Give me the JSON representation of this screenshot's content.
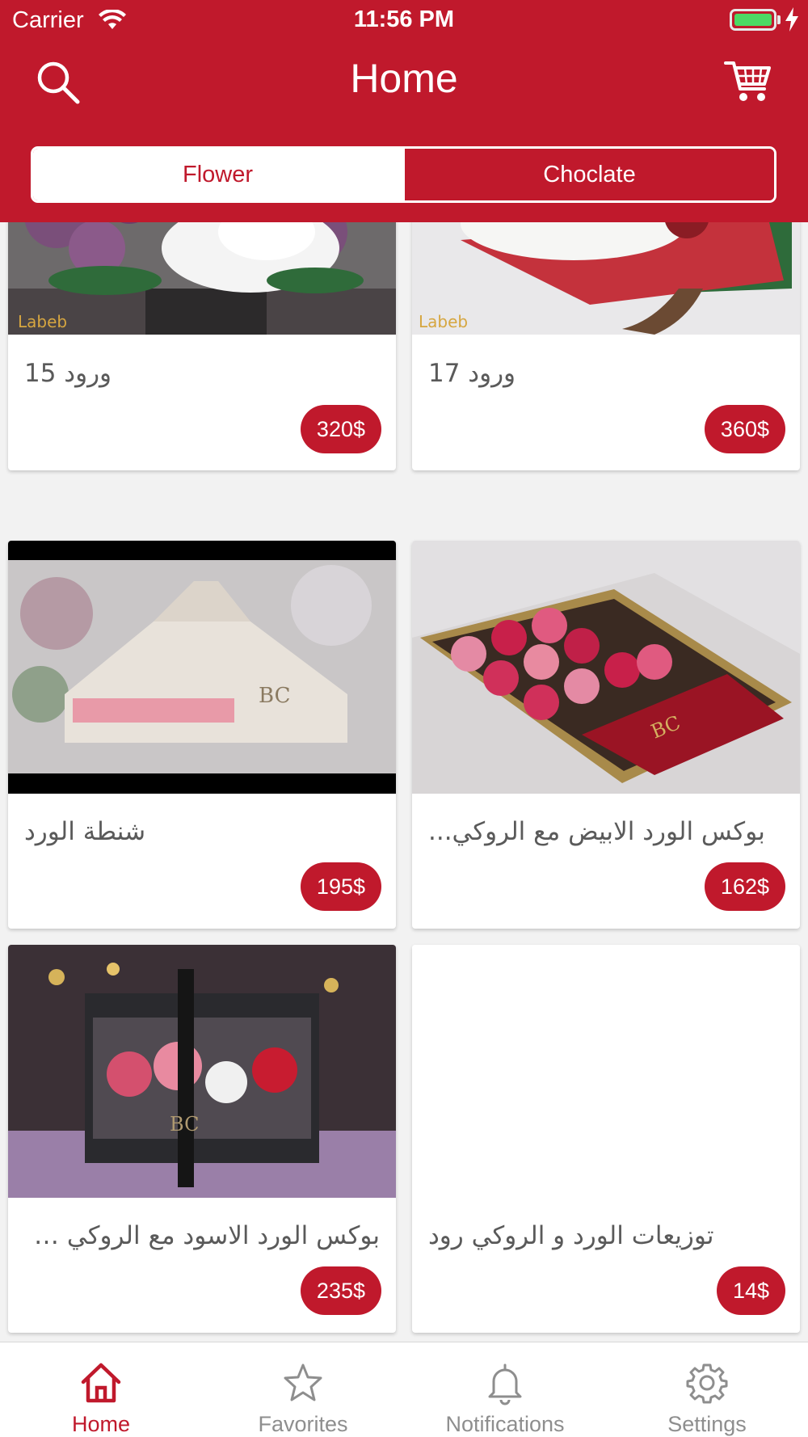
{
  "status": {
    "carrier": "Carrier",
    "time": "11:56 PM"
  },
  "nav": {
    "title": "Home",
    "search_icon": "search-icon",
    "cart_icon": "cart-icon"
  },
  "segments": [
    {
      "label": "Flower",
      "selected": true
    },
    {
      "label": "Choclate",
      "selected": false
    }
  ],
  "products": [
    {
      "name": "ورود 15",
      "price": "320$"
    },
    {
      "name": "ورود 17",
      "price": "360$"
    },
    {
      "name": "شنطة الورد",
      "price": "195$"
    },
    {
      "name": "بوكس الورد الابيض  مع الروكي...",
      "price": "162$"
    },
    {
      "name": "بوكس الورد الاسود مع الروكي رود",
      "price": "235$"
    },
    {
      "name": "توزيعات الورد و الروكي رود",
      "price": "14$"
    }
  ],
  "tabs": [
    {
      "label": "Home",
      "icon": "home-icon",
      "active": true
    },
    {
      "label": "Favorites",
      "icon": "star-icon",
      "active": false
    },
    {
      "label": "Notifications",
      "icon": "bell-icon",
      "active": false
    },
    {
      "label": "Settings",
      "icon": "gear-icon",
      "active": false
    }
  ],
  "colors": {
    "brand": "#c0192c",
    "inactive_tab": "#8e8e8e",
    "battery": "#4cd964"
  }
}
